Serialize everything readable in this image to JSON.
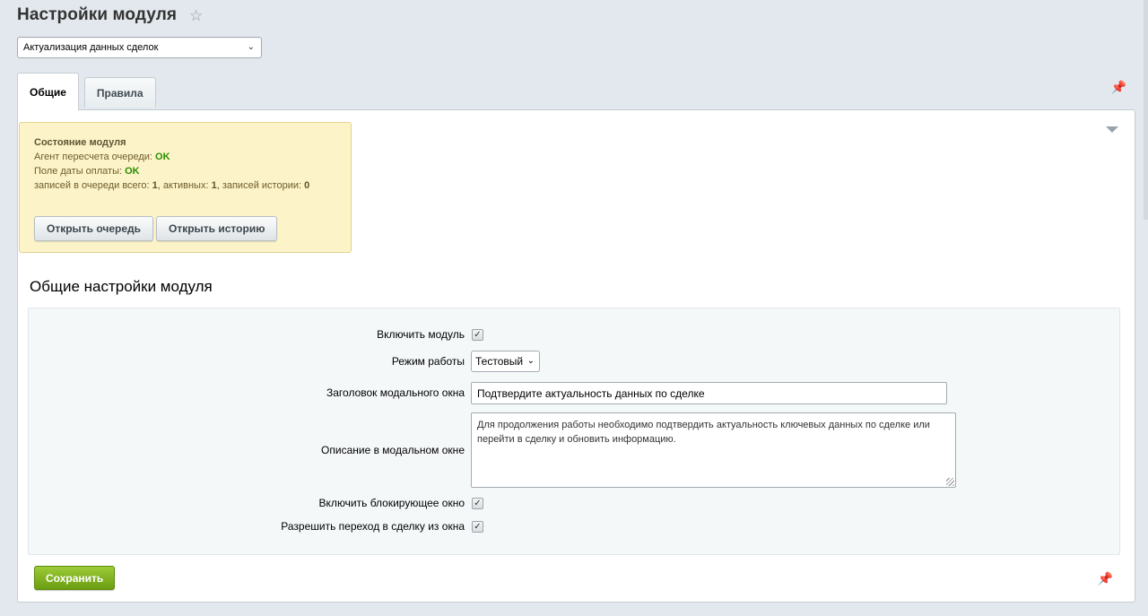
{
  "header": {
    "title": "Настройки модуля",
    "favorite_icon": "star-icon"
  },
  "module_select": {
    "value": "Актуализация данных сделок"
  },
  "tabs": [
    {
      "label": "Общие",
      "active": true
    },
    {
      "label": "Правила",
      "active": false
    }
  ],
  "status": {
    "title": "Состояние модуля",
    "agent_label": "Агент пересчета очереди: ",
    "agent_value": "OK",
    "payment_label": "Поле даты оплаты: ",
    "payment_value": "OK",
    "queue_total_label": "записей в очереди всего: ",
    "queue_total": "1",
    "active_label": ", активных: ",
    "active": "1",
    "history_label": ", записей истории: ",
    "history": "0",
    "open_queue_button": "Открыть очередь",
    "open_history_button": "Открыть историю",
    "ok_color": "#2c8e00",
    "box_color": "#fcf3c8"
  },
  "general": {
    "section_title": "Общие настройки модуля",
    "enable_module_label": "Включить модуль",
    "enable_module_checked": true,
    "mode_label": "Режим работы",
    "mode_value": "Тестовый",
    "modal_title_label": "Заголовок модального окна",
    "modal_title_value": "Подтвердите актуальность данных по сделке",
    "modal_desc_label": "Описание в модальном окне",
    "modal_desc_value": "Для продолжения работы необходимо подтвердить актуальность ключевых данных по сделке или перейти в сделку и обновить информацию.",
    "blocking_label": "Включить блокирующее окно",
    "blocking_checked": true,
    "allow_nav_label": "Разрешить переход в сделку из окна",
    "allow_nav_checked": true
  },
  "footer": {
    "save_button": "Сохранить",
    "save_color": "#7fb21f"
  }
}
